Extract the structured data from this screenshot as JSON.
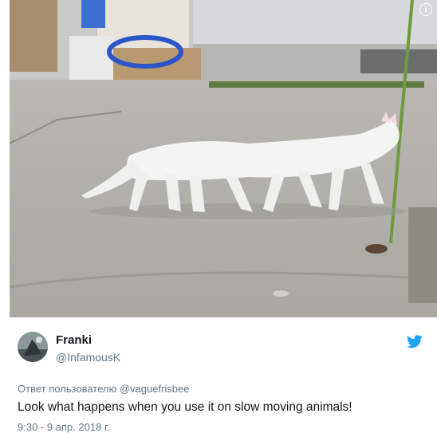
{
  "tweet": {
    "author_name": "Franki",
    "author_handle": "@InfamousK",
    "reply_prefix": "Ответ пользователю",
    "reply_to": "@vaguefrisbee",
    "text": "Look what happens when you use it on slow moving animals!",
    "timestamp": "9:30 - 9 апр. 2018 г."
  },
  "media": {
    "info_glyph": "i"
  },
  "icons": {
    "brand": "twitter-bird-icon",
    "info": "info-icon"
  },
  "colors": {
    "twitter_blue": "#1da1f2",
    "secondary_text": "#657786",
    "primary_text": "#14171a"
  }
}
